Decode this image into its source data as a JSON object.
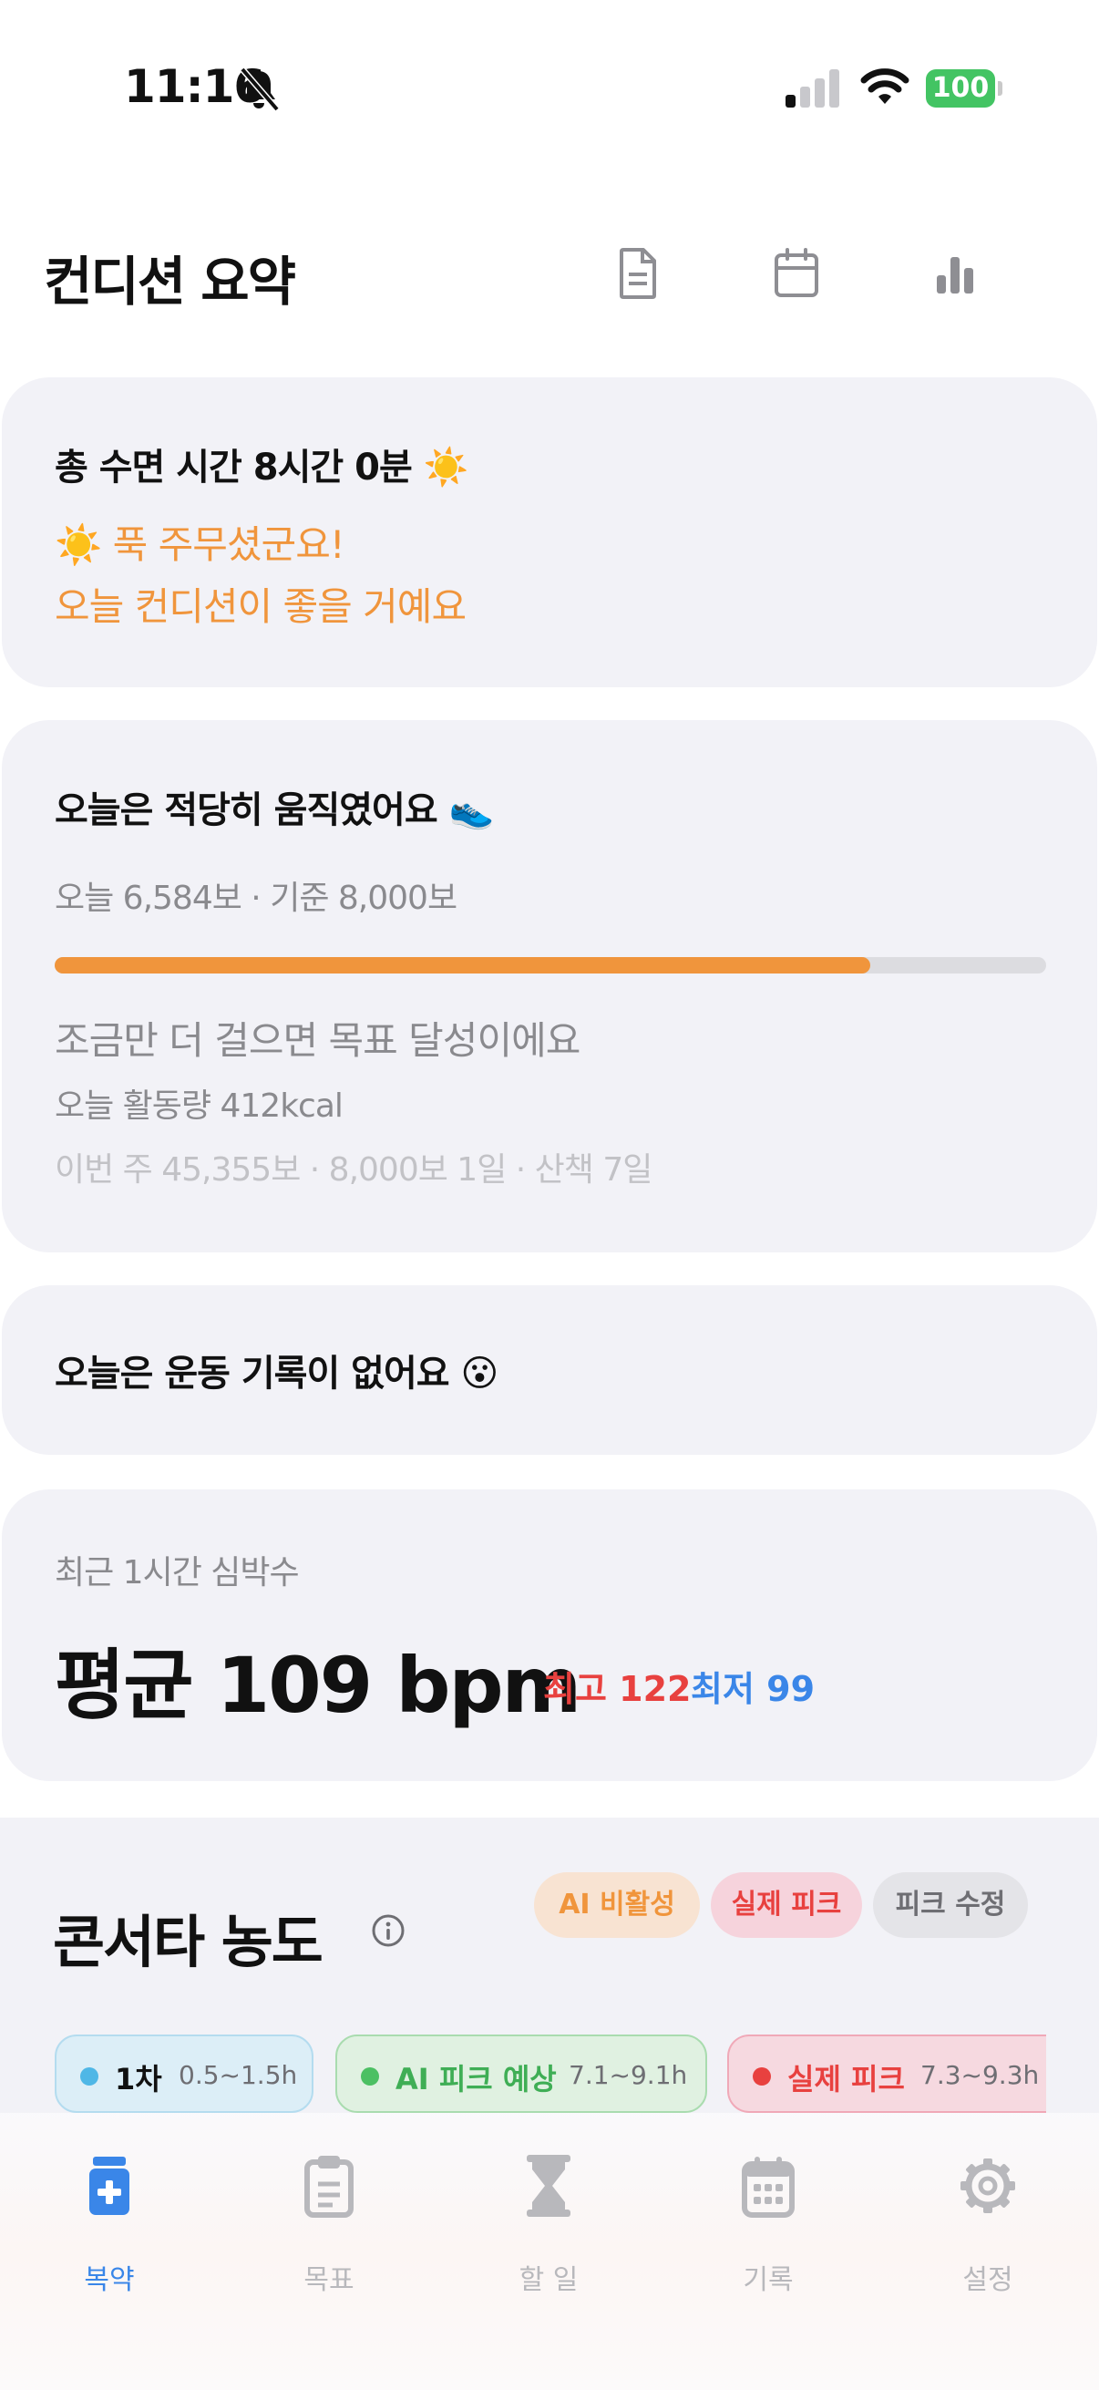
{
  "status_bar": {
    "time": "11:16",
    "battery": "100",
    "battery_color": "#43c463"
  },
  "header": {
    "title": "컨디션 요약",
    "icons": [
      "document-icon",
      "calendar-icon",
      "bar-chart-icon"
    ]
  },
  "sleep_card": {
    "title": "총 수면 시간 8시간 0분 ☀️",
    "message_line1": "☀️ 푹 주무셨군요!",
    "message_line2": "오늘 컨디션이 좋을 거예요"
  },
  "steps_card": {
    "title": "오늘은 적당히 움직였어요 👟",
    "summary": "오늘 6,584보 · 기준 8,000보",
    "progress_fraction": 0.823,
    "encouragement": "조금만 더 걸으면 목표 달성이에요",
    "activity": "오늘 활동량 412kcal",
    "weekly": "이번 주 45,355보 · 8,000보 1일 · 산책 7일"
  },
  "exercise_card": {
    "title": "오늘은 운동 기록이 없어요 😮"
  },
  "heart_card": {
    "label": "최근 1시간 심박수",
    "average": "평균 109 bpm",
    "max": "최고 122",
    "min": "최저 99"
  },
  "concerta": {
    "title": "콘서타 농도",
    "pills": {
      "ai": "AI 비활성",
      "actual": "실제 피크",
      "edit": "피크 수정"
    },
    "chips": [
      {
        "label": "1차",
        "range": "0.5~1.5h"
      },
      {
        "label": "AI 피크 예상",
        "range": "7.1~9.1h"
      },
      {
        "label": "실제 피크",
        "range": "7.3~9.3h"
      }
    ]
  },
  "tab_bar": {
    "active_color": "#3a86e8",
    "tabs": [
      {
        "label": "복약",
        "icon": "medicine-icon"
      },
      {
        "label": "목표",
        "icon": "clipboard-icon"
      },
      {
        "label": "할 일",
        "icon": "hourglass-icon"
      },
      {
        "label": "기록",
        "icon": "calendar-icon"
      },
      {
        "label": "설정",
        "icon": "gear-icon"
      }
    ]
  }
}
